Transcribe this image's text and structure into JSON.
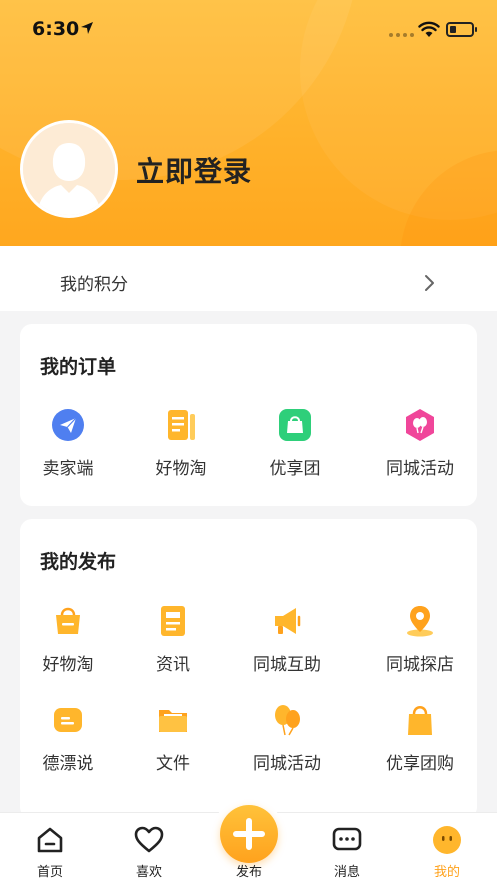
{
  "status_bar": {
    "time": "6:30"
  },
  "profile": {
    "login_text": "立即登录"
  },
  "points": {
    "label": "我的积分"
  },
  "orders": {
    "title": "我的订单",
    "items": [
      {
        "label": "卖家端",
        "icon": "paper-plane-icon"
      },
      {
        "label": "好物淘",
        "icon": "document-list-icon"
      },
      {
        "label": "优享团",
        "icon": "shopping-bag-icon"
      },
      {
        "label": "同城活动",
        "icon": "balloons-icon"
      }
    ]
  },
  "publish": {
    "title": "我的发布",
    "items": [
      {
        "label": "好物淘",
        "icon": "basket-icon"
      },
      {
        "label": "资讯",
        "icon": "news-icon"
      },
      {
        "label": "同城互助",
        "icon": "megaphone-icon"
      },
      {
        "label": "同城探店",
        "icon": "location-pin-icon"
      },
      {
        "label": "德漂说",
        "icon": "chat-bubble-icon"
      },
      {
        "label": "文件",
        "icon": "folder-icon"
      },
      {
        "label": "同城活动",
        "icon": "balloons-icon"
      },
      {
        "label": "优享团购",
        "icon": "shopping-bag-icon"
      }
    ]
  },
  "tabbar": {
    "items": [
      {
        "label": "首页",
        "icon": "home-icon"
      },
      {
        "label": "喜欢",
        "icon": "heart-icon"
      },
      {
        "label": "发布",
        "icon": "plus-icon"
      },
      {
        "label": "消息",
        "icon": "message-icon"
      },
      {
        "label": "我的",
        "icon": "profile-face-icon",
        "active": true
      }
    ]
  },
  "colors": {
    "accent": "#ffa21d",
    "header_top": "#ffbf3c",
    "blue": "#4f7ff0",
    "green": "#2ecf7a",
    "pink": "#f0469a"
  }
}
